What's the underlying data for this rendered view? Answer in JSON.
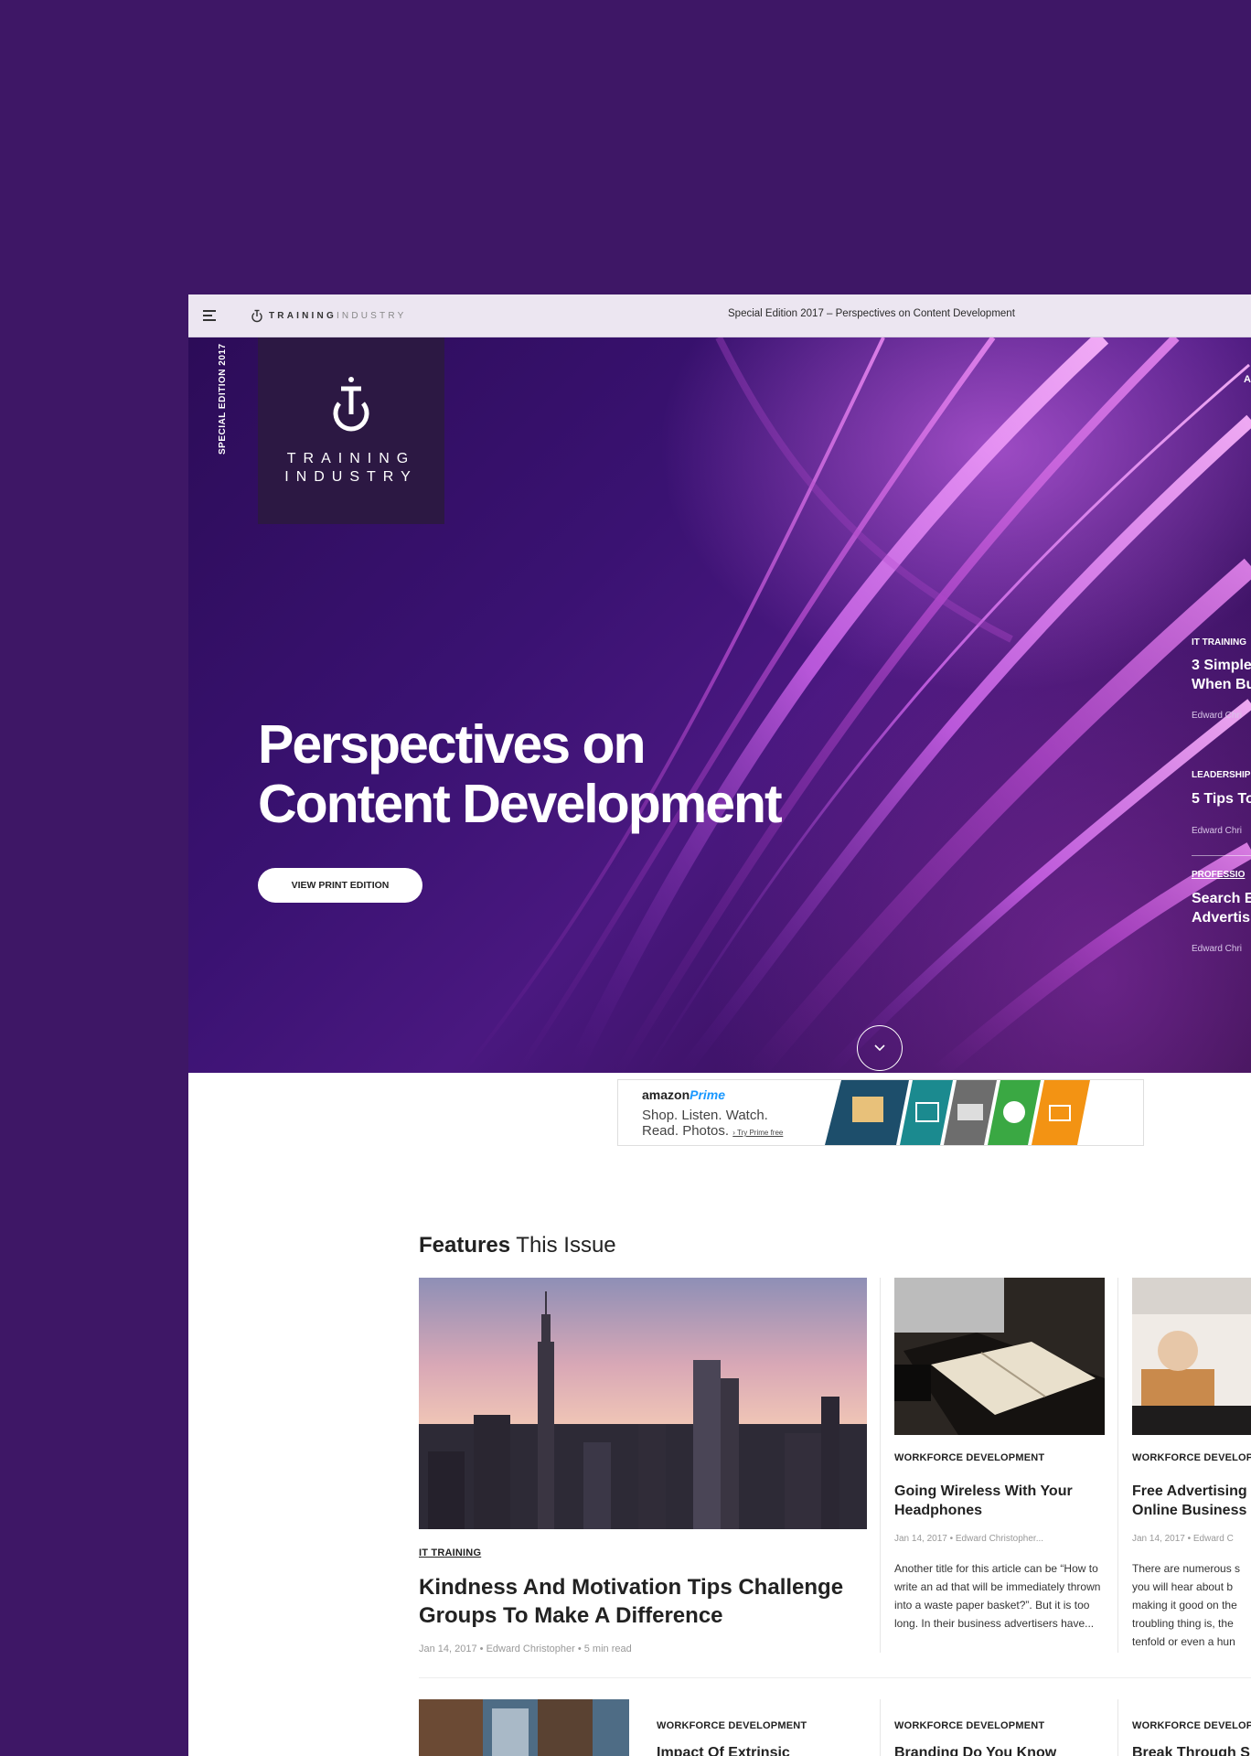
{
  "topbar": {
    "brand_bold": "TRAINING",
    "brand_light": "INDUSTRY",
    "edition_title": "Special Edition 2017 – Perspectives on Content Development"
  },
  "hero": {
    "vertical_label": "SPECIAL EDITION 2017",
    "logo_line1": "TRAINING",
    "logo_line2": "INDUSTRY",
    "title_line1": "Perspectives on",
    "title_line2": "Content Development",
    "print_button": "VIEW PRINT EDITION"
  },
  "side_list": {
    "top_item": "AR",
    "items": [
      {
        "category": "IT TRAINING",
        "title_line1": "3 Simple",
        "title_line2": "When Bu",
        "author": "Edward Chri"
      },
      {
        "category": "LEADERSHIP",
        "title_line1": "5 Tips To",
        "title_line2": "",
        "author": "Edward Chri"
      },
      {
        "category": "PROFESSIO",
        "title_line1": "Search E",
        "title_line2": "Advertis",
        "author": "Edward Chri"
      }
    ]
  },
  "ad": {
    "logo_amazon": "amazon",
    "logo_prime": "Prime",
    "line1": "Shop. Listen. Watch.",
    "line2": "Read. Photos.",
    "link": "› Try Prime free",
    "tile_colors": [
      "#1d4e6b",
      "#1b8a8f",
      "#6d6d6d",
      "#3aa843",
      "#f39313"
    ]
  },
  "features": {
    "heading_bold": "Features",
    "heading_light": "This Issue",
    "big_card": {
      "category": "IT TRAINING",
      "title": "Kindness And Motivation Tips Challenge Groups To Make A Difference",
      "meta": "Jan 14, 2017 • Edward Christopher • 5 min read"
    },
    "card2": {
      "category": "WORKFORCE DEVELOPMENT",
      "title": "Going Wireless With Your Headphones",
      "meta": "Jan 14, 2017 • Edward Christopher...",
      "body": "Another title for this article can be “How to write an ad that will be immediately thrown into a waste paper basket?”. But it is too long. In their business advertisers have..."
    },
    "card3": {
      "category": "WORKFORCE DEVELOP",
      "title_line1": "Free Advertising",
      "title_line2": "Online Business",
      "meta": "Jan 14, 2017 • Edward C",
      "body_lines": [
        "There are numerous s",
        "you will hear about b",
        "making it good on the",
        "troubling thing is, the",
        "tenfold or even a hun"
      ]
    },
    "row2": [
      {
        "category": "WORKFORCE DEVELOPMENT",
        "title": "Impact Of Extrinsic"
      },
      {
        "category": "WORKFORCE DEVELOPMENT",
        "title": "Branding Do You Know"
      },
      {
        "category": "WORKFORCE DEVELOP",
        "title": "Break Through S"
      }
    ]
  }
}
